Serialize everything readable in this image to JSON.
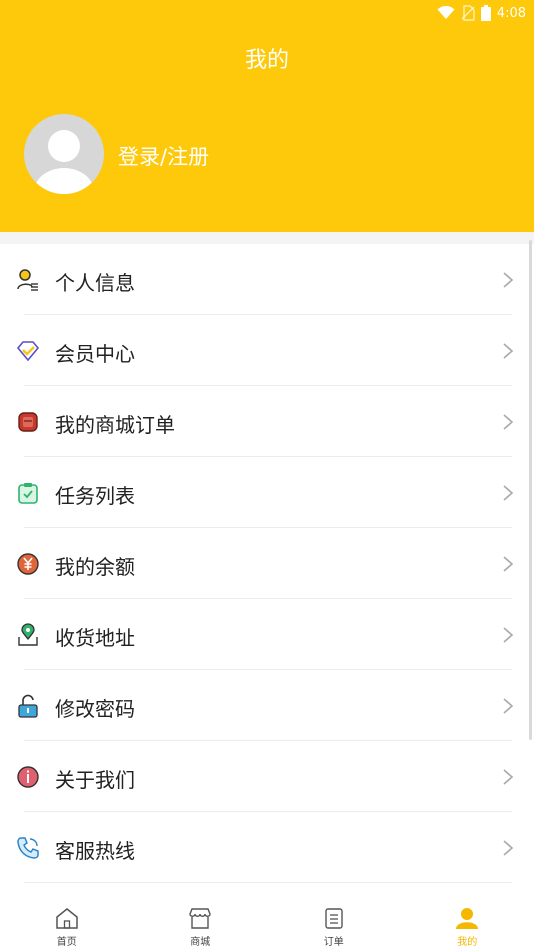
{
  "status_bar": {
    "time": "4:08"
  },
  "header": {
    "title": "我的",
    "login_label": "登录/注册"
  },
  "menu": [
    {
      "label": "个人信息",
      "icon": "person-info-icon"
    },
    {
      "label": "会员中心",
      "icon": "diamond-icon"
    },
    {
      "label": "我的商城订单",
      "icon": "order-bag-icon"
    },
    {
      "label": "任务列表",
      "icon": "task-clipboard-icon"
    },
    {
      "label": "我的余额",
      "icon": "yen-coin-icon"
    },
    {
      "label": "收货地址",
      "icon": "location-pin-icon"
    },
    {
      "label": "修改密码",
      "icon": "unlock-icon"
    },
    {
      "label": "关于我们",
      "icon": "info-circle-icon"
    },
    {
      "label": "客服热线",
      "icon": "phone-icon"
    }
  ],
  "tabbar": [
    {
      "label": "首页",
      "icon": "home-icon"
    },
    {
      "label": "商城",
      "icon": "store-icon"
    },
    {
      "label": "订单",
      "icon": "order-icon"
    },
    {
      "label": "我的",
      "icon": "profile-icon",
      "active": true
    }
  ],
  "colors": {
    "accent": "#fdc90a",
    "active_tab": "#f5b800"
  }
}
